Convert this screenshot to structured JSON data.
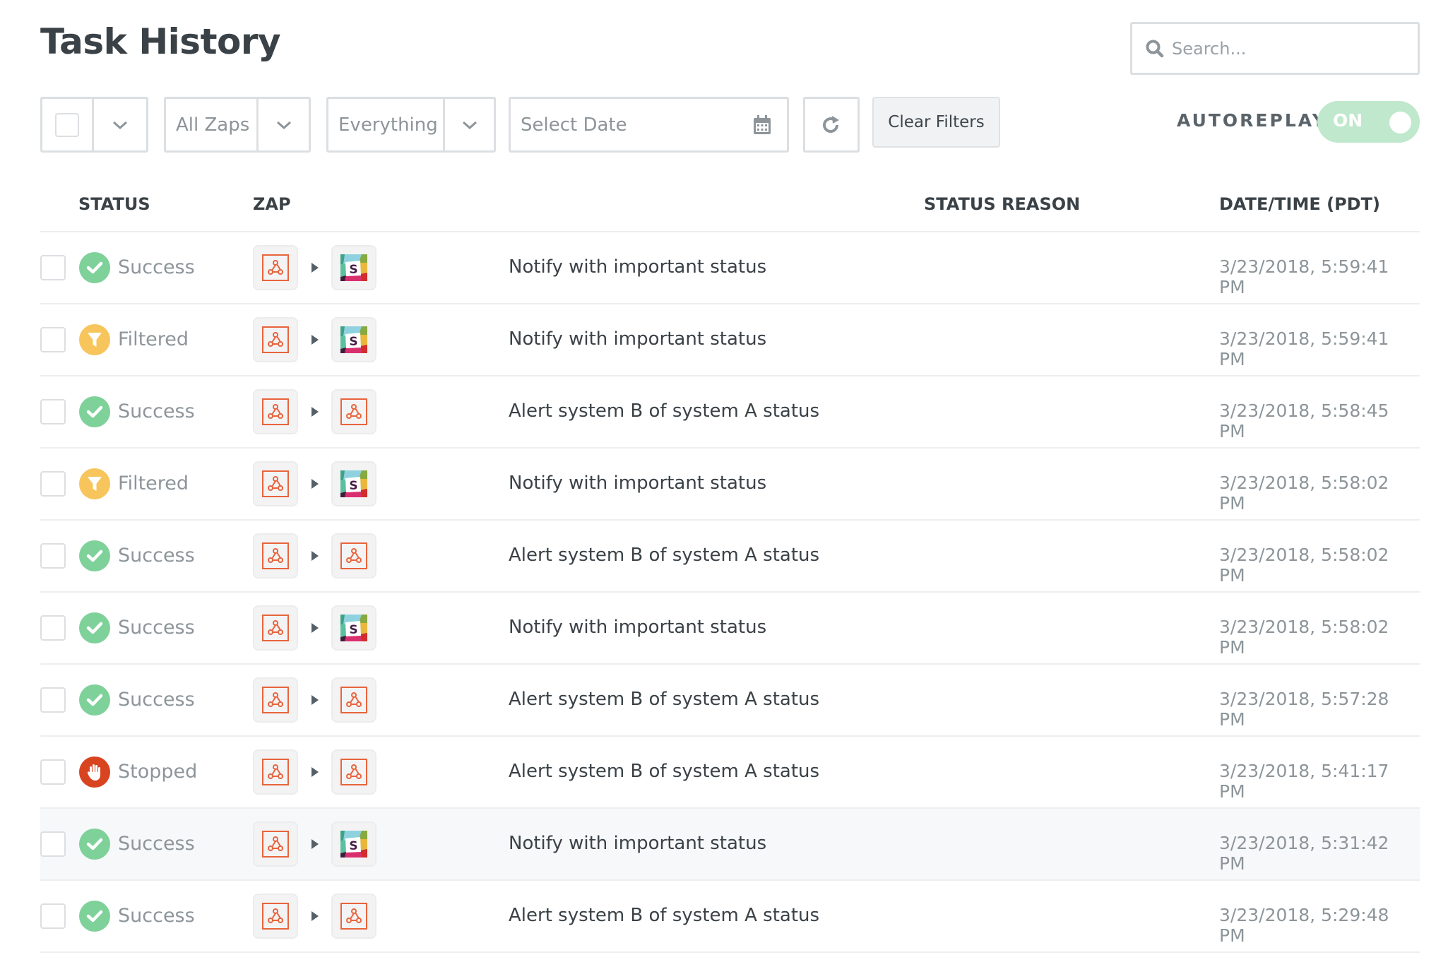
{
  "page": {
    "title": "Task History"
  },
  "search": {
    "placeholder": "Search..."
  },
  "toolbar": {
    "select_all_checked": false,
    "zaps_filter": "All Zaps",
    "status_filter": "Everything",
    "date_placeholder": "Select Date",
    "clear_filters_label": "Clear Filters",
    "autoreplay_label": "AUTOREPLAY",
    "autoreplay_state": "ON"
  },
  "colors": {
    "success": "#7fd19a",
    "filtered": "#f7c55c",
    "stopped": "#d8441f",
    "webhook": "#e8643c",
    "toggle_on": "#bfe8cd"
  },
  "table": {
    "columns": [
      "STATUS",
      "ZAP",
      "STATUS REASON",
      "DATE/TIME (PDT)"
    ],
    "rows": [
      {
        "status": "Success",
        "apps": [
          "webhook",
          "slack"
        ],
        "zap": "Notify with important status",
        "reason": "",
        "datetime": "3/23/2018, 5:59:41 PM"
      },
      {
        "status": "Filtered",
        "apps": [
          "webhook",
          "slack"
        ],
        "zap": "Notify with important status",
        "reason": "",
        "datetime": "3/23/2018, 5:59:41 PM"
      },
      {
        "status": "Success",
        "apps": [
          "webhook",
          "webhook"
        ],
        "zap": "Alert system B of system A status",
        "reason": "",
        "datetime": "3/23/2018, 5:58:45 PM"
      },
      {
        "status": "Filtered",
        "apps": [
          "webhook",
          "slack"
        ],
        "zap": "Notify with important status",
        "reason": "",
        "datetime": "3/23/2018, 5:58:02 PM"
      },
      {
        "status": "Success",
        "apps": [
          "webhook",
          "webhook"
        ],
        "zap": "Alert system B of system A status",
        "reason": "",
        "datetime": "3/23/2018, 5:58:02 PM"
      },
      {
        "status": "Success",
        "apps": [
          "webhook",
          "slack"
        ],
        "zap": "Notify with important status",
        "reason": "",
        "datetime": "3/23/2018, 5:58:02 PM"
      },
      {
        "status": "Success",
        "apps": [
          "webhook",
          "webhook"
        ],
        "zap": "Alert system B of system A status",
        "reason": "",
        "datetime": "3/23/2018, 5:57:28 PM"
      },
      {
        "status": "Stopped",
        "apps": [
          "webhook",
          "webhook"
        ],
        "zap": "Alert system B of system A status",
        "reason": "",
        "datetime": "3/23/2018, 5:41:17 PM"
      },
      {
        "status": "Success",
        "apps": [
          "webhook",
          "slack"
        ],
        "zap": "Notify with important status",
        "reason": "",
        "datetime": "3/23/2018, 5:31:42 PM",
        "hovered": true
      },
      {
        "status": "Success",
        "apps": [
          "webhook",
          "webhook"
        ],
        "zap": "Alert system B of system A status",
        "reason": "",
        "datetime": "3/23/2018, 5:29:48 PM"
      }
    ]
  }
}
